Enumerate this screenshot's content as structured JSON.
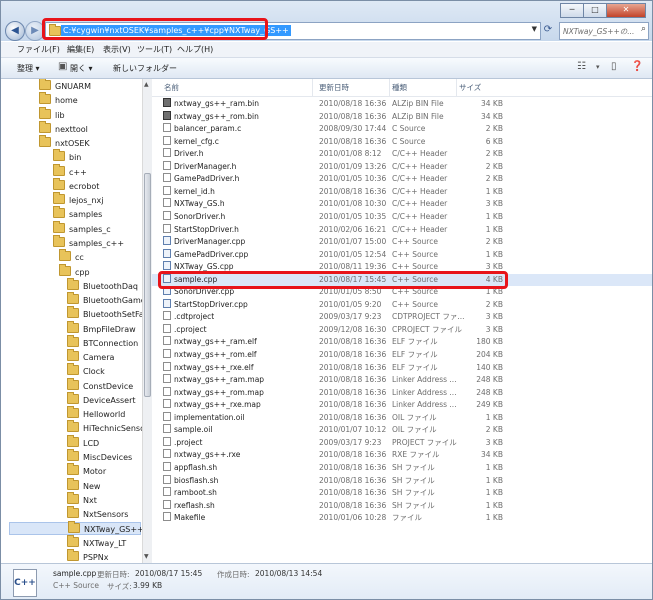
{
  "window": {
    "controls": {
      "minimize": "─",
      "maximize": "□",
      "close": "✕"
    },
    "back_glyph": "◀",
    "forward_glyph": "▶",
    "address": "C:¥cygwin¥nxtOSEK¥samples_c++¥cpp¥NXTway_GS++",
    "search_placeholder": "NXTway_GS++の..."
  },
  "menu": [
    "ファイル(F)",
    "編集(E)",
    "表示(V)",
    "ツール(T)",
    "ヘルプ(H)"
  ],
  "toolbar": {
    "organize": "整理 ▾",
    "open": "開く ▾",
    "new_folder": "新しいフォルダー"
  },
  "tree": [
    {
      "label": "GNUARM",
      "indent": 0
    },
    {
      "label": "home",
      "indent": 0
    },
    {
      "label": "lib",
      "indent": 0
    },
    {
      "label": "nexttool",
      "indent": 0
    },
    {
      "label": "nxtOSEK",
      "indent": 0
    },
    {
      "label": "bin",
      "indent": 1
    },
    {
      "label": "c++",
      "indent": 1
    },
    {
      "label": "ecrobot",
      "indent": 1
    },
    {
      "label": "lejos_nxj",
      "indent": 1
    },
    {
      "label": "samples",
      "indent": 1
    },
    {
      "label": "samples_c",
      "indent": 1
    },
    {
      "label": "samples_c++",
      "indent": 1
    },
    {
      "label": "cc",
      "indent": 2
    },
    {
      "label": "cpp",
      "indent": 2
    },
    {
      "label": "BluetoothDaq",
      "indent": 3
    },
    {
      "label": "BluetoothGamePad",
      "indent": 3
    },
    {
      "label": "BluetoothSetFactor",
      "indent": 3
    },
    {
      "label": "BmpFileDraw",
      "indent": 3
    },
    {
      "label": "BTConnection",
      "indent": 3
    },
    {
      "label": "Camera",
      "indent": 3
    },
    {
      "label": "Clock",
      "indent": 3
    },
    {
      "label": "ConstDevice",
      "indent": 3
    },
    {
      "label": "DeviceAssert",
      "indent": 3
    },
    {
      "label": "Helloworld",
      "indent": 3
    },
    {
      "label": "HiTechnicSensors",
      "indent": 3
    },
    {
      "label": "LCD",
      "indent": 3
    },
    {
      "label": "MiscDevices",
      "indent": 3
    },
    {
      "label": "Motor",
      "indent": 3
    },
    {
      "label": "New",
      "indent": 3
    },
    {
      "label": "Nxt",
      "indent": 3
    },
    {
      "label": "NxtSensors",
      "indent": 3
    },
    {
      "label": "NXTway_GS++",
      "indent": 3,
      "selected": true
    },
    {
      "label": "NXTway_LT",
      "indent": 3
    },
    {
      "label": "PSPNx",
      "indent": 3
    }
  ],
  "columns": {
    "name": "名前",
    "date": "更新日時",
    "type": "種類",
    "size": "サイズ"
  },
  "files": [
    {
      "name": "nxtway_gs++_ram.bin",
      "date": "2010/08/18 16:36",
      "type": "ALZip BIN File",
      "size": "34 KB",
      "icon": "zip"
    },
    {
      "name": "nxtway_gs++_rom.bin",
      "date": "2010/08/18 16:36",
      "type": "ALZip BIN File",
      "size": "34 KB",
      "icon": "zip"
    },
    {
      "name": "balancer_param.c",
      "date": "2008/09/30 17:44",
      "type": "C Source",
      "size": "2 KB",
      "icon": "doc"
    },
    {
      "name": "kernel_cfg.c",
      "date": "2010/08/18 16:36",
      "type": "C Source",
      "size": "6 KB",
      "icon": "doc"
    },
    {
      "name": "Driver.h",
      "date": "2010/01/08 8:12",
      "type": "C/C++ Header",
      "size": "2 KB",
      "icon": "doc"
    },
    {
      "name": "DriverManager.h",
      "date": "2010/01/09 13:26",
      "type": "C/C++ Header",
      "size": "2 KB",
      "icon": "doc"
    },
    {
      "name": "GamePadDriver.h",
      "date": "2010/01/05 10:36",
      "type": "C/C++ Header",
      "size": "2 KB",
      "icon": "doc"
    },
    {
      "name": "kernel_id.h",
      "date": "2010/08/18 16:36",
      "type": "C/C++ Header",
      "size": "1 KB",
      "icon": "doc"
    },
    {
      "name": "NXTway_GS.h",
      "date": "2010/01/08 10:30",
      "type": "C/C++ Header",
      "size": "3 KB",
      "icon": "doc"
    },
    {
      "name": "SonorDriver.h",
      "date": "2010/01/05 10:35",
      "type": "C/C++ Header",
      "size": "1 KB",
      "icon": "doc"
    },
    {
      "name": "StartStopDriver.h",
      "date": "2010/02/06 16:21",
      "type": "C/C++ Header",
      "size": "1 KB",
      "icon": "doc"
    },
    {
      "name": "DriverManager.cpp",
      "date": "2010/01/07 15:00",
      "type": "C++ Source",
      "size": "2 KB",
      "icon": "cpp"
    },
    {
      "name": "GamePadDriver.cpp",
      "date": "2010/01/05 12:54",
      "type": "C++ Source",
      "size": "1 KB",
      "icon": "cpp"
    },
    {
      "name": "NXTway_GS.cpp",
      "date": "2010/08/11 19:36",
      "type": "C++ Source",
      "size": "3 KB",
      "icon": "cpp"
    },
    {
      "name": "sample.cpp",
      "date": "2010/08/17 15:45",
      "type": "C++ Source",
      "size": "4 KB",
      "icon": "cpp",
      "selected": true
    },
    {
      "name": "SonorDriver.cpp",
      "date": "2010/01/05 8:50",
      "type": "C++ Source",
      "size": "1 KB",
      "icon": "cpp"
    },
    {
      "name": "StartStopDriver.cpp",
      "date": "2010/01/05 9:20",
      "type": "C++ Source",
      "size": "2 KB",
      "icon": "cpp"
    },
    {
      "name": ".cdtproject",
      "date": "2009/03/17 9:23",
      "type": "CDTPROJECT ファ...",
      "size": "3 KB",
      "icon": "doc"
    },
    {
      "name": ".cproject",
      "date": "2009/12/08 16:30",
      "type": "CPROJECT ファイル",
      "size": "3 KB",
      "icon": "doc"
    },
    {
      "name": "nxtway_gs++_ram.elf",
      "date": "2010/08/18 16:36",
      "type": "ELF ファイル",
      "size": "180 KB",
      "icon": "doc"
    },
    {
      "name": "nxtway_gs++_rom.elf",
      "date": "2010/08/18 16:36",
      "type": "ELF ファイル",
      "size": "204 KB",
      "icon": "doc"
    },
    {
      "name": "nxtway_gs++_rxe.elf",
      "date": "2010/08/18 16:36",
      "type": "ELF ファイル",
      "size": "140 KB",
      "icon": "doc"
    },
    {
      "name": "nxtway_gs++_ram.map",
      "date": "2010/08/18 16:36",
      "type": "Linker Address ...",
      "size": "248 KB",
      "icon": "doc"
    },
    {
      "name": "nxtway_gs++_rom.map",
      "date": "2010/08/18 16:36",
      "type": "Linker Address ...",
      "size": "248 KB",
      "icon": "doc"
    },
    {
      "name": "nxtway_gs++_rxe.map",
      "date": "2010/08/18 16:36",
      "type": "Linker Address ...",
      "size": "249 KB",
      "icon": "doc"
    },
    {
      "name": "implementation.oil",
      "date": "2010/08/18 16:36",
      "type": "OIL ファイル",
      "size": "1 KB",
      "icon": "doc"
    },
    {
      "name": "sample.oil",
      "date": "2010/01/07 10:12",
      "type": "OIL ファイル",
      "size": "2 KB",
      "icon": "doc"
    },
    {
      "name": ".project",
      "date": "2009/03/17 9:23",
      "type": "PROJECT ファイル",
      "size": "3 KB",
      "icon": "doc"
    },
    {
      "name": "nxtway_gs++.rxe",
      "date": "2010/08/18 16:36",
      "type": "RXE ファイル",
      "size": "34 KB",
      "icon": "doc"
    },
    {
      "name": "appflash.sh",
      "date": "2010/08/18 16:36",
      "type": "SH ファイル",
      "size": "1 KB",
      "icon": "doc"
    },
    {
      "name": "biosflash.sh",
      "date": "2010/08/18 16:36",
      "type": "SH ファイル",
      "size": "1 KB",
      "icon": "doc"
    },
    {
      "name": "ramboot.sh",
      "date": "2010/08/18 16:36",
      "type": "SH ファイル",
      "size": "1 KB",
      "icon": "doc"
    },
    {
      "name": "rxeflash.sh",
      "date": "2010/08/18 16:36",
      "type": "SH ファイル",
      "size": "1 KB",
      "icon": "doc"
    },
    {
      "name": "Makefile",
      "date": "2010/01/06 10:28",
      "type": "ファイル",
      "size": "1 KB",
      "icon": "doc"
    }
  ],
  "details": {
    "icon_text": "C++",
    "filename": "sample.cpp",
    "modified_label": "更新日時:",
    "modified": "2010/08/17 15:45",
    "created_label": "作成日時:",
    "created": "2010/08/13 14:54",
    "type": "C++ Source",
    "size_label": "サイズ:",
    "size": "3.99 KB"
  },
  "colors": {
    "highlight_red": "#e8141a",
    "selection_blue": "#3399ff"
  }
}
